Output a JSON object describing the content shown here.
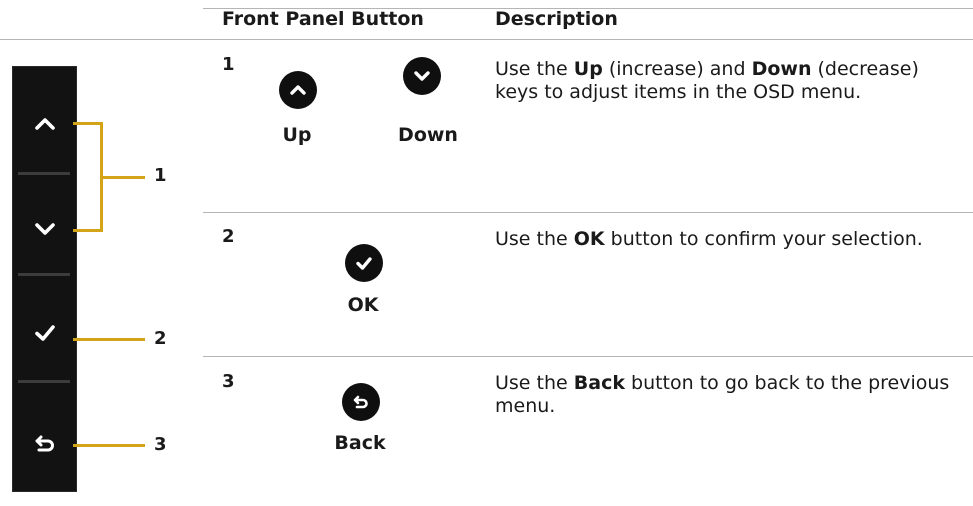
{
  "table": {
    "headers": {
      "button": "Front Panel Button",
      "description": "Description"
    },
    "rows": [
      {
        "number": "1",
        "buttons": [
          {
            "label": "Up",
            "icon": "chevron-up-icon"
          },
          {
            "label": "Down",
            "icon": "chevron-down-icon"
          }
        ],
        "description": {
          "t1": "Use the ",
          "b1": "Up",
          "t2": " (increase) and ",
          "b2": "Down",
          "t3": " (decrease) keys to adjust items in the OSD menu."
        }
      },
      {
        "number": "2",
        "buttons": [
          {
            "label": "OK",
            "icon": "check-icon"
          }
        ],
        "description": {
          "t1": "Use the ",
          "b1": "OK",
          "t2": " button to confirm your selection."
        }
      },
      {
        "number": "3",
        "buttons": [
          {
            "label": "Back",
            "icon": "back-arrow-icon"
          }
        ],
        "description": {
          "t1": "Use the ",
          "b1": "Back",
          "t2": " button to go back to the previous menu."
        }
      }
    ]
  },
  "panel": {
    "callouts": [
      "1",
      "2",
      "3"
    ],
    "icons": [
      "chevron-up-icon",
      "chevron-down-icon",
      "check-icon",
      "back-arrow-icon"
    ],
    "accent_color": "#d4a418"
  }
}
